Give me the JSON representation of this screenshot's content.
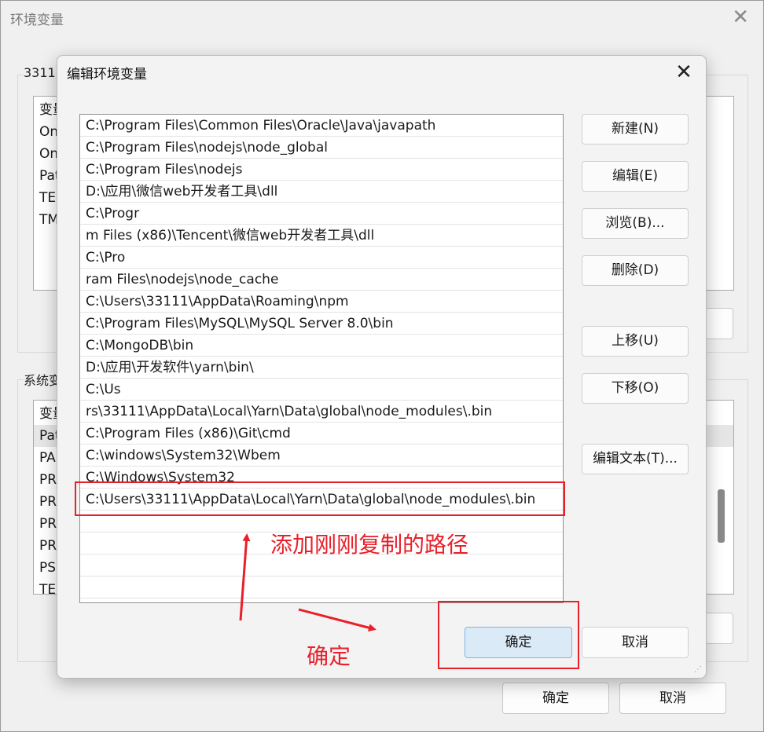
{
  "background_window": {
    "title": "环境变量",
    "user_group_label": "3311",
    "user_list": [
      "变量",
      "On",
      "On",
      "Pat",
      "TEI",
      "TM"
    ],
    "system_group_label": "系统变",
    "system_list": [
      "变量",
      "Pat",
      "PA",
      "PR",
      "PR",
      "PR",
      "PR",
      "PSI",
      "TEI"
    ],
    "ok_label": "确定",
    "cancel_label": "取消"
  },
  "dialog": {
    "title": "编辑环境变量",
    "paths": [
      "C:\\Program Files\\Common Files\\Oracle\\Java\\javapath",
      "C:\\Program Files\\nodejs\\node_global",
      "C:\\Program Files\\nodejs",
      "D:\\应用\\微信web开发者工具\\dll",
      "C:\\Progr",
      "m Files (x86)\\Tencent\\微信web开发者工具\\dll",
      "C:\\Pro",
      "ram Files\\nodejs\\node_cache",
      "C:\\Users\\33111\\AppData\\Roaming\\npm",
      "C:\\Program Files\\MySQL\\MySQL Server 8.0\\bin",
      "C:\\MongoDB\\bin",
      "D:\\应用\\开发软件\\yarn\\bin\\",
      "C:\\Us",
      "rs\\33111\\AppData\\Local\\Yarn\\Data\\global\\node_modules\\.bin",
      "C:\\Program Files (x86)\\Git\\cmd",
      "C:\\windows\\System32\\Wbem",
      "C:\\Windows\\System32",
      "C:\\Users\\33111\\AppData\\Local\\Yarn\\Data\\global\\node_modules\\.bin",
      "",
      "",
      "",
      ""
    ],
    "buttons": {
      "new": "新建(N)",
      "edit": "编辑(E)",
      "browse": "浏览(B)...",
      "delete": "删除(D)",
      "move_up": "上移(U)",
      "move_down": "下移(O)",
      "edit_text": "编辑文本(T)...",
      "ok": "确定",
      "cancel": "取消"
    }
  },
  "annotations": {
    "add_path_note": "添加刚刚复制的路径",
    "confirm_note": "确定",
    "color": "#e8202a"
  }
}
